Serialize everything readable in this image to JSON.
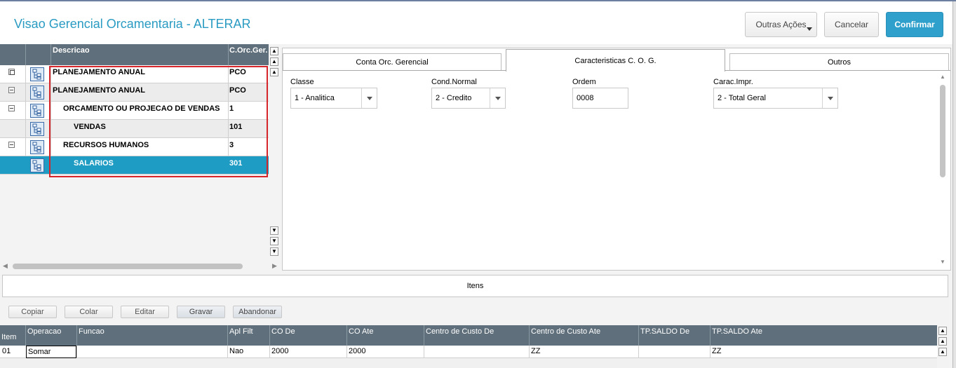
{
  "header": {
    "title": "Visao Gerencial Orcamentaria - ALTERAR",
    "btn_outras": "Outras Ações",
    "btn_cancelar": "Cancelar",
    "btn_confirmar": "Confirmar"
  },
  "tree": {
    "col_descricao": "Descricao",
    "col_corc": "C.Orc.Ger.",
    "rows": [
      {
        "descricao": "PLANEJAMENTO ANUAL",
        "corc": "PCO"
      },
      {
        "descricao": "PLANEJAMENTO ANUAL",
        "corc": "PCO"
      },
      {
        "descricao": "ORCAMENTO OU PROJECAO DE VENDAS",
        "corc": "1"
      },
      {
        "descricao": "VENDAS",
        "corc": "101"
      },
      {
        "descricao": "RECURSOS HUMANOS",
        "corc": "3"
      },
      {
        "descricao": "SALARIOS",
        "corc": "301"
      }
    ]
  },
  "tabs": [
    {
      "label": "Conta Orc. Gerencial"
    },
    {
      "label": "Caracteristicas C. O. G."
    },
    {
      "label": "Outros"
    }
  ],
  "form": {
    "classe_label": "Classe",
    "classe_value": "1 - Analitica",
    "cond_label": "Cond.Normal",
    "cond_value": "2 - Credito",
    "ordem_label": "Ordem",
    "ordem_value": "0008",
    "carac_label": "Carac.Impr.",
    "carac_value": "2 - Total Geral"
  },
  "itens": {
    "title": "Itens",
    "buttons": {
      "copiar": "Copiar",
      "colar": "Colar",
      "editar": "Editar",
      "gravar": "Gravar",
      "abandonar": "Abandonar"
    },
    "columns": [
      "Item",
      "Operacao",
      "Funcao",
      "Apl Filt",
      "CO De",
      "CO Ate",
      "Centro de Custo De",
      "Centro de Custo Ate",
      "TP.SALDO De",
      "TP.SALDO Ate"
    ],
    "row": {
      "item": "01",
      "operacao": "Somar",
      "funcao": "",
      "apl_filt": "Nao",
      "co_de": "2000",
      "co_ate": "2000",
      "cc_de": "",
      "cc_ate": "ZZ",
      "tp_de": "",
      "tp_ate": "ZZ"
    }
  }
}
